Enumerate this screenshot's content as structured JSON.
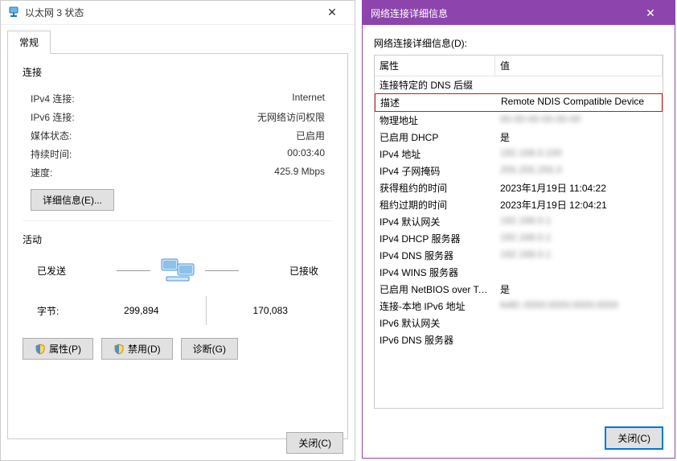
{
  "left": {
    "title": "以太网 3 状态",
    "tab_general": "常规",
    "group_connection": "连接",
    "rows": {
      "ipv4_label": "IPv4 连接:",
      "ipv4_value": "Internet",
      "ipv6_label": "IPv6 连接:",
      "ipv6_value": "无网络访问权限",
      "media_label": "媒体状态:",
      "media_value": "已启用",
      "duration_label": "持续时间:",
      "duration_value": "00:03:40",
      "speed_label": "速度:",
      "speed_value": "425.9 Mbps"
    },
    "details_btn": "详细信息(E)...",
    "group_activity": "活动",
    "sent_label": "已发送",
    "recv_label": "已接收",
    "bytes_label": "字节:",
    "bytes_sent": "299,894",
    "bytes_recv": "170,083",
    "properties_btn": "属性(P)",
    "disable_btn": "禁用(D)",
    "diagnose_btn": "诊断(G)",
    "close_btn": "关闭(C)"
  },
  "right": {
    "title": "网络连接详细信息",
    "subtitle": "网络连接详细信息(D):",
    "header_prop": "属性",
    "header_val": "值",
    "rows": [
      {
        "prop": "连接特定的 DNS 后缀",
        "val": "",
        "blur": false
      },
      {
        "prop": "描述",
        "val": "Remote NDIS Compatible Device",
        "blur": false,
        "highlight": true
      },
      {
        "prop": "物理地址",
        "val": "00-00-00-00-00-00",
        "blur": true
      },
      {
        "prop": "已启用 DHCP",
        "val": "是",
        "blur": false
      },
      {
        "prop": "IPv4 地址",
        "val": "192.168.0.100",
        "blur": true
      },
      {
        "prop": "IPv4 子网掩码",
        "val": "255.255.255.0",
        "blur": true
      },
      {
        "prop": "获得租约的时间",
        "val": "2023年1月19日 11:04:22",
        "blur": false
      },
      {
        "prop": "租约过期的时间",
        "val": "2023年1月19日 12:04:21",
        "blur": false
      },
      {
        "prop": "IPv4 默认网关",
        "val": "192.168.0.1",
        "blur": true
      },
      {
        "prop": "IPv4 DHCP 服务器",
        "val": "192.168.0.1",
        "blur": true
      },
      {
        "prop": "IPv4 DNS 服务器",
        "val": "192.168.0.1",
        "blur": true
      },
      {
        "prop": "IPv4 WINS 服务器",
        "val": "",
        "blur": false
      },
      {
        "prop": "已启用 NetBIOS over Tc...",
        "val": "是",
        "blur": false
      },
      {
        "prop": "连接-本地 IPv6 地址",
        "val": "fe80::0000:0000:0000:0000",
        "blur": true
      },
      {
        "prop": "IPv6 默认网关",
        "val": "",
        "blur": false
      },
      {
        "prop": "IPv6 DNS 服务器",
        "val": "",
        "blur": false
      }
    ],
    "close_btn": "关闭(C)"
  }
}
